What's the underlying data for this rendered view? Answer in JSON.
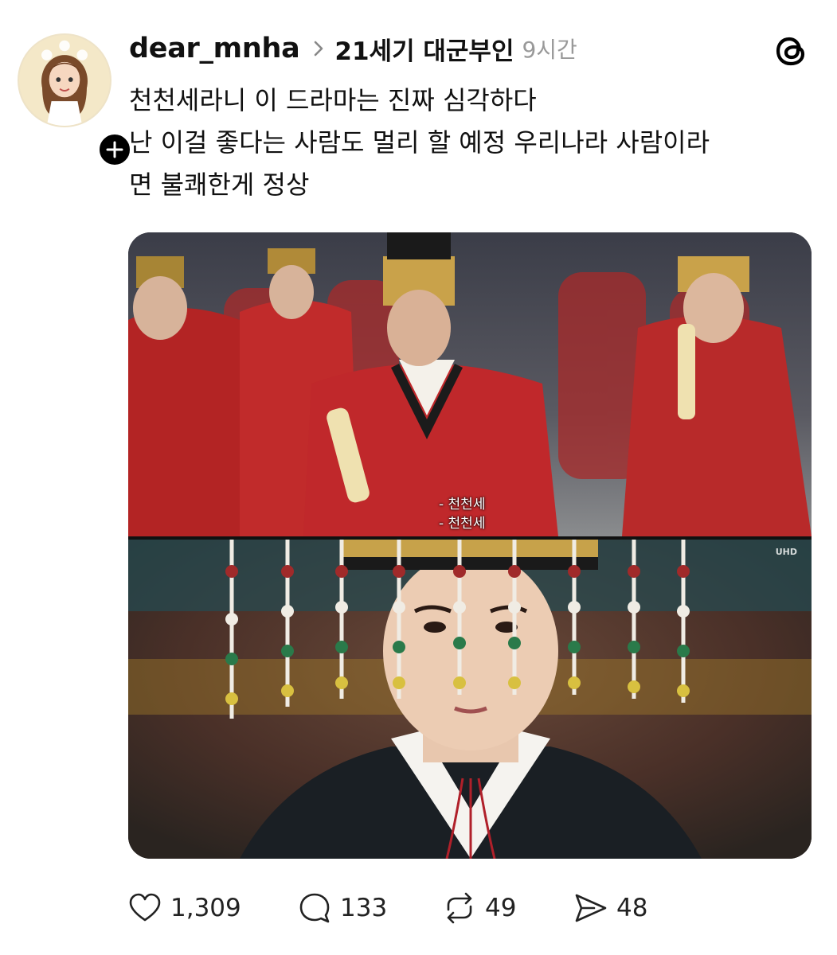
{
  "post": {
    "username": "dear_mnha",
    "community": "21세기 대군부인",
    "time": "9시간",
    "text_lines": [
      "천천세라니 이 드라마는 진짜 심각하다",
      "난 이걸 좋다는 사람도 멀리 할 예정 우리나라 사람이라",
      "면 불쾌한게 정상"
    ]
  },
  "media": {
    "subtitle_lines": [
      "- 천천세",
      "- 천천세"
    ],
    "badge": "UHD"
  },
  "actions": {
    "likes": "1,309",
    "replies": "133",
    "reposts": "49",
    "shares": "48"
  },
  "icons": {
    "like": "heart-icon",
    "reply": "speech-bubble-icon",
    "repost": "repost-arrows-icon",
    "share": "send-icon",
    "logo": "threads-logo-icon",
    "follow": "plus-icon",
    "separator": "chevron-right-icon"
  }
}
